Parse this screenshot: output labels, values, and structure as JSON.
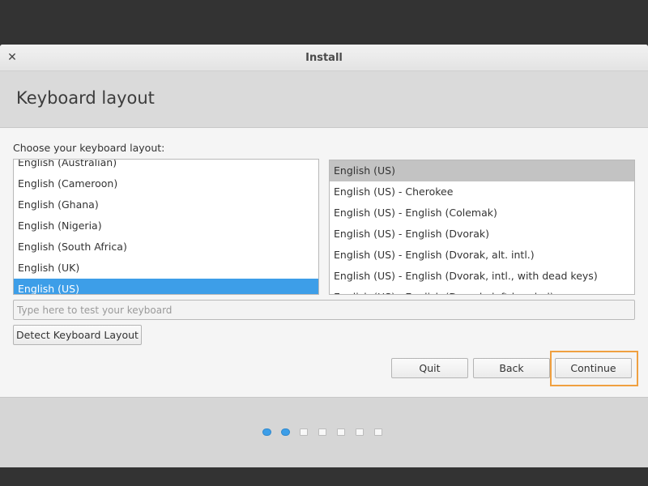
{
  "window": {
    "title": "Install",
    "close_glyph": "✕"
  },
  "page": {
    "title": "Keyboard layout",
    "prompt": "Choose your keyboard layout:"
  },
  "layout_list": {
    "items": [
      "English (Australian)",
      "English (Cameroon)",
      "English (Ghana)",
      "English (Nigeria)",
      "English (South Africa)",
      "English (UK)",
      "English (US)"
    ],
    "selected": "English (US)"
  },
  "variant_list": {
    "items": [
      "English (US)",
      "English (US) - Cherokee",
      "English (US) - English (Colemak)",
      "English (US) - English (Dvorak)",
      "English (US) - English (Dvorak, alt. intl.)",
      "English (US) - English (Dvorak, intl., with dead keys)",
      "English (US) - English (Dvorak, left-handed)"
    ],
    "selected": "English (US)"
  },
  "test_input": {
    "placeholder": "Type here to test your keyboard",
    "value": ""
  },
  "buttons": {
    "detect": "Detect Keyboard Layout",
    "quit": "Quit",
    "back": "Back",
    "continue": "Continue"
  },
  "progress": {
    "total_steps": 7,
    "completed_steps": 2
  },
  "colors": {
    "selection_blue": "#3d9ee8",
    "selection_grey": "#c3c3c3",
    "highlight_orange": "#f0a040"
  },
  "icons": {
    "close": "close-icon"
  }
}
